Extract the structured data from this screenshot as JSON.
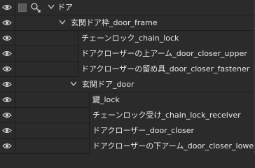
{
  "layers": {
    "root": {
      "label": "ドア"
    },
    "frame_group": {
      "label": "玄関ドア枠_door_frame"
    },
    "frame_items": [
      {
        "label": "チェーンロック_chain_lock"
      },
      {
        "label": "ドアクローザーの上アーム_door_closer_upper"
      },
      {
        "label": "ドアクローザーの留め具_door_closer_fastener"
      }
    ],
    "door_group": {
      "label": "玄関ドア_door"
    },
    "door_items": [
      {
        "label": "鍵_lock"
      },
      {
        "label": "チェーンロック受け_chain_lock_receiver"
      },
      {
        "label": "ドアクローザー_door_closer"
      },
      {
        "label": "ドアクローザーの下アーム_door_closer_lower"
      }
    ]
  },
  "colors": {
    "background": "#2b2b2b",
    "divider": "#1c1c1c",
    "text": "#e8e8e8",
    "icon": "#cfcfcf"
  },
  "icons": {
    "visibility": "eye-icon",
    "expand": "chevron-down-icon",
    "link": "link-icon"
  }
}
